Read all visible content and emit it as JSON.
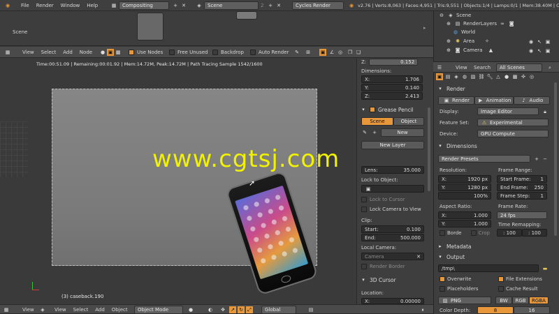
{
  "topbar": {
    "menus": [
      "File",
      "Render",
      "Window",
      "Help"
    ],
    "screen_layout": "Compositing",
    "scene": "Scene",
    "scene_count": "2",
    "engine": "Cycles Render",
    "stats": "v2.76 | Verts:8,063 | Faces:4,951 | Tris:9,551 | Objects:1/4 | Lamps:0/1 | Mem:38.40M | Cam"
  },
  "node_area": {
    "scene_label": "Scene"
  },
  "node_header": {
    "menus": [
      "View",
      "Select",
      "Add",
      "Node"
    ],
    "use_nodes": "Use Nodes",
    "free_unused": "Free Unused",
    "backdrop": "Backdrop",
    "auto_render": "Auto Render"
  },
  "viewport": {
    "render_info": "Time:00:51.09 | Remaining:00:01.92 | Mem:14.72M, Peak:14.72M | Path Tracing Sample 1542/1600",
    "object_label": "(3) caseback.190",
    "watermark": "www.cgtsj.com"
  },
  "bottom_header": {
    "menus": [
      "View",
      "Select",
      "Add",
      "Object"
    ],
    "mode": "Object Mode",
    "transform": "Global",
    "left_view": "View"
  },
  "props_panel": {
    "z_label": "Z:",
    "z_value": "0.152",
    "dimensions": "Dimensions:",
    "dim_x_label": "X:",
    "dim_x": "1.706",
    "dim_y_label": "Y:",
    "dim_y": "0.140",
    "dim_z_label": "Z:",
    "dim_z": "2.413",
    "grease_pencil": "Grease Pencil",
    "gp_tab_scene": "Scene",
    "gp_tab_object": "Object",
    "gp_new": "New",
    "gp_new_layer": "New Layer",
    "lens_label": "Lens:",
    "lens_value": "35.000",
    "lock_to_object": "Lock to Object:",
    "lock_to_cursor": "Lock to Cursor",
    "lock_camera_to_view": "Lock Camera to View",
    "clip": "Clip:",
    "clip_start_label": "Start:",
    "clip_start": "0.100",
    "clip_end_label": "End:",
    "clip_end": "500.000",
    "local_camera": "Local Camera:",
    "camera": "Camera",
    "render_border": "Render Border",
    "cursor3d": "3D Cursor",
    "location": "Location:",
    "loc_x_label": "X:",
    "loc_x": "0.00000"
  },
  "outliner": {
    "items": [
      "Scene",
      "RenderLayers",
      "World",
      "Area",
      "Camera"
    ],
    "menus": [
      "View",
      "Search"
    ],
    "filter": "All Scenes"
  },
  "render_props": {
    "section": "Render",
    "btn_render": "Render",
    "btn_animation": "Animation",
    "btn_audio": "Audio",
    "display_label": "Display:",
    "display_value": "Image Editor",
    "feature_label": "Feature Set:",
    "feature_value": "Experimental",
    "device_label": "Device:",
    "device_value": "GPU Compute",
    "dimensions": "Dimensions",
    "presets": "Render Presets",
    "resolution": "Resolution:",
    "res_x_label": "X:",
    "res_x": "1920 px",
    "res_y_label": "Y:",
    "res_y": "1280 px",
    "res_pct": "100%",
    "frame_range": "Frame Range:",
    "start_frame_label": "Start Frame:",
    "start_frame": "1",
    "end_frame_label": "End Frame:",
    "end_frame": "250",
    "frame_step_label": "Frame Step:",
    "frame_step": "1",
    "aspect": "Aspect Ratio:",
    "asp_x_label": "X:",
    "asp_x": "1.000",
    "asp_y_label": "Y:",
    "asp_y": "1.000",
    "frame_rate": "Frame Rate:",
    "fps": "24 fps",
    "time_remap": "Time Remapping:",
    "remap_old": ": 100",
    "remap_new": ": 100",
    "border": "Borde",
    "crop": "Crop",
    "metadata": "Metadata",
    "output": "Output",
    "path": "/tmp\\",
    "overwrite": "Overwrite",
    "file_ext": "File Extensions",
    "placeholders": "Placeholders",
    "cache_result": "Cache Result",
    "format": "PNG",
    "bw": "BW",
    "rgb": "RGB",
    "rgba": "RGBA",
    "color_depth": "Color Depth:",
    "depth8": "8",
    "depth16": "16"
  },
  "colors": {
    "accent": "#e8973a",
    "watermark": "#f2f200",
    "panel": "#393939",
    "header": "#4a4a4a"
  }
}
